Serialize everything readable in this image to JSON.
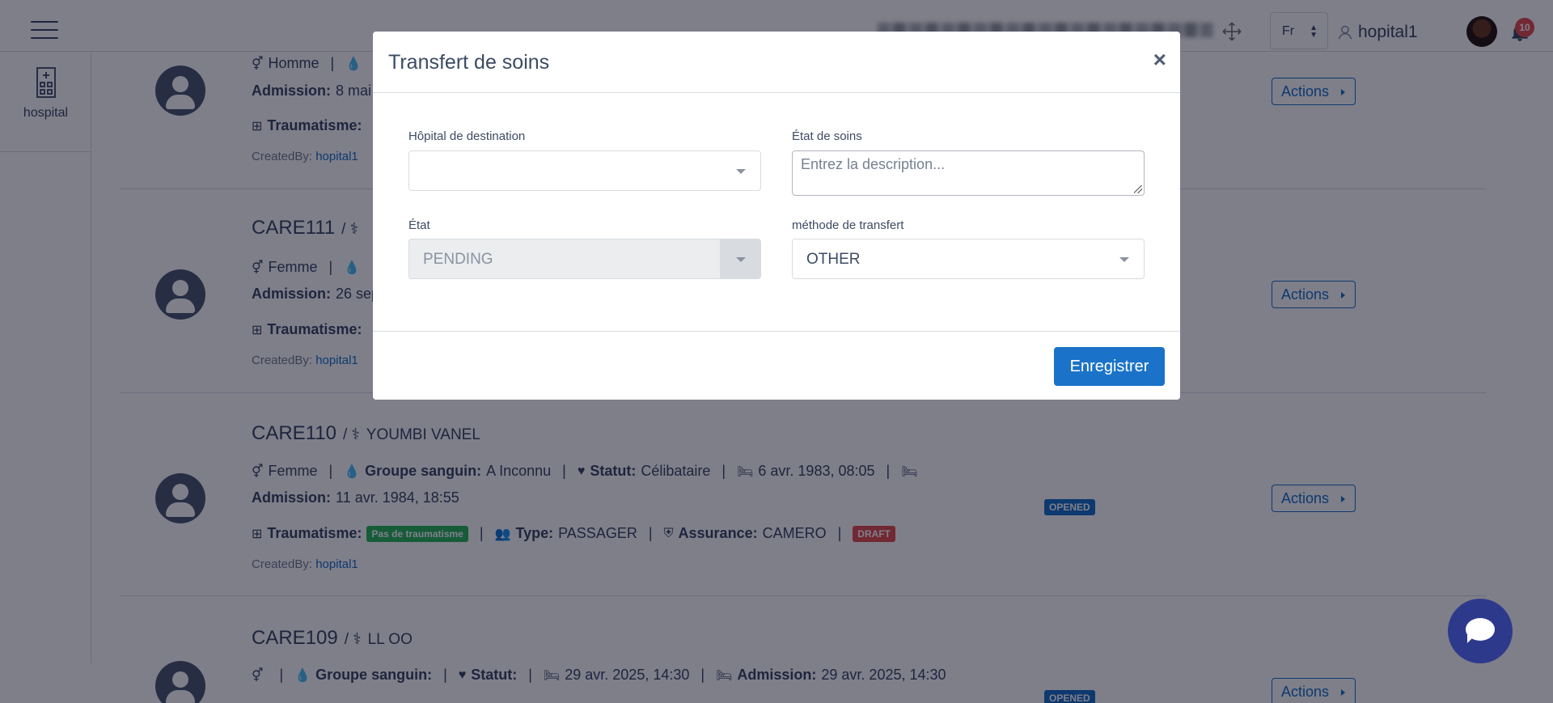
{
  "header": {
    "language": "Fr",
    "username": "hopital1",
    "notification_count": "10"
  },
  "sidebar": {
    "items": [
      {
        "label": "hospital",
        "icon": "hospital-icon"
      }
    ]
  },
  "cares": [
    {
      "id": "",
      "patient": "",
      "line1": {
        "gender": "Homme"
      },
      "admission_label": "Admission:",
      "admission": "8 mai",
      "traumatisme_label": "Traumatisme:",
      "created_label": "CreatedBy:",
      "created_by": "hopital1",
      "actions_label": "Actions"
    },
    {
      "id": "CARE111",
      "patient": "",
      "line1": {
        "gender": "Femme"
      },
      "admission_label": "Admission:",
      "admission": "26 sep",
      "traumatisme_label": "Traumatisme:",
      "created_label": "CreatedBy:",
      "created_by": "hopital1",
      "actions_label": "Actions"
    },
    {
      "id": "CARE110",
      "patient": "YOUMBI VANEL",
      "line1": {
        "gender": "Femme",
        "blood_label": "Groupe sanguin:",
        "blood": "A Inconnu",
        "statut_label": "Statut:",
        "statut": "Célibataire",
        "birth": "6 avr. 1983, 08:05"
      },
      "admission_label": "Admission:",
      "admission": "11 avr. 1984, 18:55",
      "traumatisme_label": "Traumatisme:",
      "traumatisme": "Pas de traumatisme",
      "type_label": "Type:",
      "type": "PASSAGER",
      "assurance_label": "Assurance:",
      "assurance": "CAMERO",
      "draft": "DRAFT",
      "status": "OPENED",
      "created_label": "CreatedBy:",
      "created_by": "hopital1",
      "actions_label": "Actions"
    },
    {
      "id": "CARE109",
      "patient": "LL OO",
      "line1": {
        "gender": "",
        "blood_label": "Groupe sanguin:",
        "statut_label": "Statut:",
        "birth": "29 avr. 2025, 14:30",
        "admission_label": "Admission:",
        "admission": "29 avr. 2025, 14:30"
      },
      "status": "OPENED",
      "actions_label": "Actions"
    }
  ],
  "modal": {
    "title": "Transfert de soins",
    "close": "×",
    "dest_label": "Hôpital de destination",
    "dest_value": "",
    "etat_soins_label": "État de soins",
    "etat_soins_placeholder": "Entrez la description...",
    "etat_label": "État",
    "etat_value": "PENDING",
    "methode_label": "méthode de transfert",
    "methode_value": "OTHER",
    "save_label": "Enregistrer"
  },
  "colors": {
    "primary": "#1a73c8",
    "success": "#2eb85c",
    "danger": "#e55353",
    "overlay": "rgba(0,0,21,0.5)",
    "chat": "#2d3a8c"
  }
}
